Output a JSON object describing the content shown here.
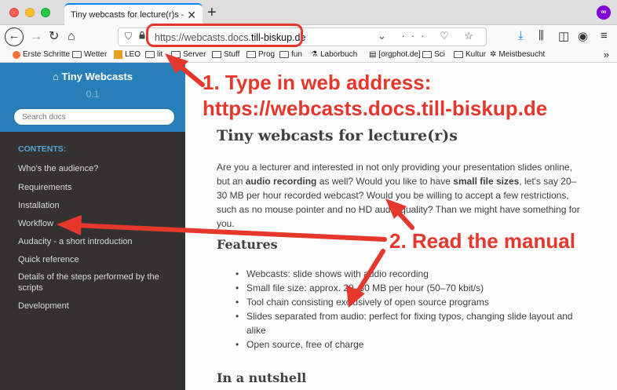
{
  "browser": {
    "tab_title": "Tiny webcasts for lecture(r)s — Tiny",
    "tab_close": "✕",
    "new_tab": "+",
    "url_prefix": "https://webcasts.docs.",
    "url_domain": "till-biskup.de",
    "url_actions": "⌄ ··· ♡ ☆",
    "bookmarks": [
      "Erste Schritte",
      "Wetter",
      "LEO",
      "lit",
      "Server",
      "Stuff",
      "Prog",
      "fun",
      "Laborbuch",
      "[orgphot.de]",
      "Sci",
      "Kultur",
      "Meistbesucht"
    ],
    "bookmarks_more": "»",
    "colors": {
      "accent": "#0a84ff",
      "annotation": "#e5372b"
    }
  },
  "sidebar": {
    "project_icon": "home-icon",
    "project_name": "Tiny Webcasts",
    "version": "0.1",
    "search_placeholder": "Search docs",
    "contents_caption": "CONTENTS:",
    "items": [
      "Who's the audience?",
      "Requirements",
      "Installation",
      "Workflow",
      "Audacity - a short introduction",
      "Quick reference",
      "Details of the steps performed by the scripts",
      "Development"
    ]
  },
  "main": {
    "title": "Tiny webcasts for lecture(r)s",
    "intro_parts": [
      "Are you a lecturer and interested in not only providing your presentation slides online, but an ",
      "audio recording",
      " as well? Would you like to have ",
      "small file sizes",
      ", let's say 20–30 MB per hour recorded webcast? Would you be willing to accept a few restrictions, such as no mouse pointer and no HD audio quality? Than we might have something for you."
    ],
    "features_heading": "Features",
    "features": [
      "Webcasts: slide shows with audio recording",
      "Small file size: approx. 20–30 MB per hour (50–70 kbit/s)",
      "Tool chain consisting exclusively of open source programs",
      "Slides separated from audio: perfect for fixing typos, changing slide layout and alike",
      "Open source, free of charge"
    ],
    "nutshell_heading": "In a nutshell"
  },
  "annotations": {
    "step1_line1": "1. Type in web address:",
    "step1_line2": "https://webcasts.docs.till-biskup.de",
    "step2": "2. Read the manual"
  }
}
